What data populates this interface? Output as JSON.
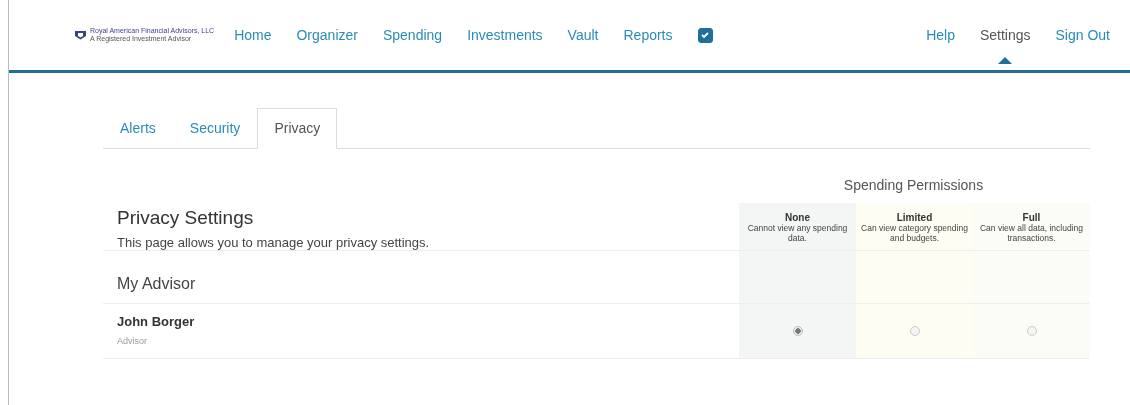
{
  "logo": {
    "name": "Royal American Financial Advisors, LLC",
    "tagline": "A Registered Investment Advisor"
  },
  "nav": [
    {
      "label": "Home",
      "selected": false
    },
    {
      "label": "Organizer",
      "selected": false
    },
    {
      "label": "Spending",
      "selected": false
    },
    {
      "label": "Investments",
      "selected": false
    },
    {
      "label": "Vault",
      "selected": false
    },
    {
      "label": "Reports",
      "selected": false
    }
  ],
  "nav_check": {
    "checked": true
  },
  "nav_right": [
    {
      "label": "Help",
      "selected": false
    },
    {
      "label": "Settings",
      "selected": true
    },
    {
      "label": "Sign Out",
      "selected": false
    }
  ],
  "tabs": [
    {
      "label": "Alerts",
      "selected": false
    },
    {
      "label": "Security",
      "selected": false
    },
    {
      "label": "Privacy",
      "selected": true
    }
  ],
  "permissions_title": "Spending Permissions",
  "page_title": "Privacy Settings",
  "page_description": "This page allows you to manage your privacy settings.",
  "levels": [
    {
      "name": "None",
      "description": "Cannot view any spending data."
    },
    {
      "name": "Limited",
      "description": "Can view category spending and budgets."
    },
    {
      "name": "Full",
      "description": "Can view all data, including transactions."
    }
  ],
  "section_title": "My Advisor",
  "advisors": [
    {
      "name": "John Borger",
      "role": "Advisor",
      "permissions": [
        {
          "selected": true
        },
        {
          "selected": false
        },
        {
          "selected": false
        }
      ]
    }
  ]
}
